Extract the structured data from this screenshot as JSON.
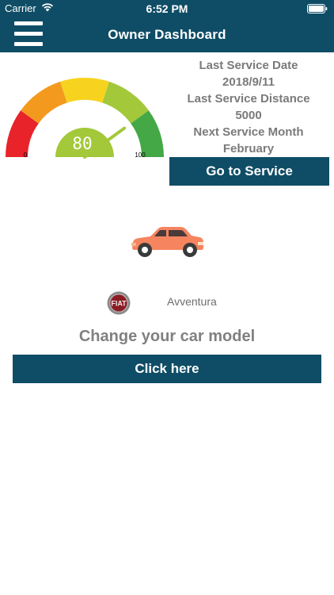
{
  "status_bar": {
    "carrier": "Carrier",
    "time": "6:52 PM"
  },
  "header": {
    "title": "Owner Dashboard",
    "menu_icon": "hamburger-menu-icon"
  },
  "gauge": {
    "value": "80",
    "min_label": "0",
    "max_label": "100",
    "level": 80,
    "zones": [
      "#e8232a",
      "#f39a1e",
      "#f7d31f",
      "#a3c83a",
      "#43a845"
    ],
    "center_color": "#a3c83a"
  },
  "service": {
    "last_date_label": "Last Service Date",
    "last_date": "2018/9/11",
    "last_distance_label": "Last Service Distance",
    "last_distance": "5000",
    "next_month_label": "Next Service Month",
    "next_month": "February",
    "button_label": "Go to Service"
  },
  "vehicle": {
    "car_icon": "car-icon",
    "brand_logo": "fiat-logo",
    "brand_logo_text": "FIAT",
    "model": "Avventura",
    "change_prompt": "Change your car model",
    "change_button": "Click here"
  },
  "colors": {
    "primary": "#0f4d66",
    "car": "#f5845f"
  }
}
